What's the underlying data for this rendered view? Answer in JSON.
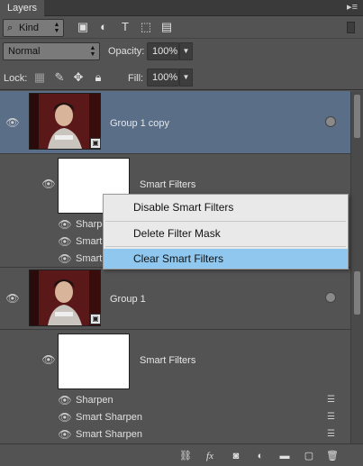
{
  "panel": {
    "tab_label": "Layers",
    "menu_glyph": "▸≡"
  },
  "filter_row": {
    "kind_label": "Kind",
    "icons": [
      "pixel-filter-icon",
      "adjustment-filter-icon",
      "type-filter-icon",
      "shape-filter-icon",
      "smart-object-filter-icon"
    ],
    "icon_glyphs": [
      "▣",
      "◐",
      "T",
      "⬚",
      "▤"
    ]
  },
  "blend_row": {
    "mode_value": "Normal",
    "opacity_label": "Opacity:",
    "opacity_value": "100%"
  },
  "lock_row": {
    "lock_label": "Lock:",
    "fill_label": "Fill:",
    "fill_value": "100%"
  },
  "layers": [
    {
      "name": "Group 1 copy",
      "selected": true,
      "mask_label": "Smart Filters",
      "filters": [
        "Sharpen",
        "Smart Sharpen",
        "Smart Sharpen"
      ]
    },
    {
      "name": "Group 1",
      "selected": false,
      "mask_label": "Smart Filters",
      "filters": [
        "Sharpen",
        "Smart Sharpen",
        "Smart Sharpen"
      ]
    }
  ],
  "context_menu": {
    "items": [
      "Disable Smart Filters",
      "Delete Filter Mask",
      "Clear Smart Filters"
    ],
    "highlighted_index": 2
  },
  "bottom_bar": {
    "icons": [
      "link-layers-icon",
      "fx-icon",
      "add-mask-icon",
      "adjustment-layer-icon",
      "new-group-icon",
      "new-layer-icon",
      "delete-layer-icon"
    ]
  },
  "colors": {
    "panel_bg": "#535353",
    "selected_row": "#5b6e87",
    "menu_bg": "#e9e9e9",
    "menu_highlight": "#8fc7ee"
  }
}
